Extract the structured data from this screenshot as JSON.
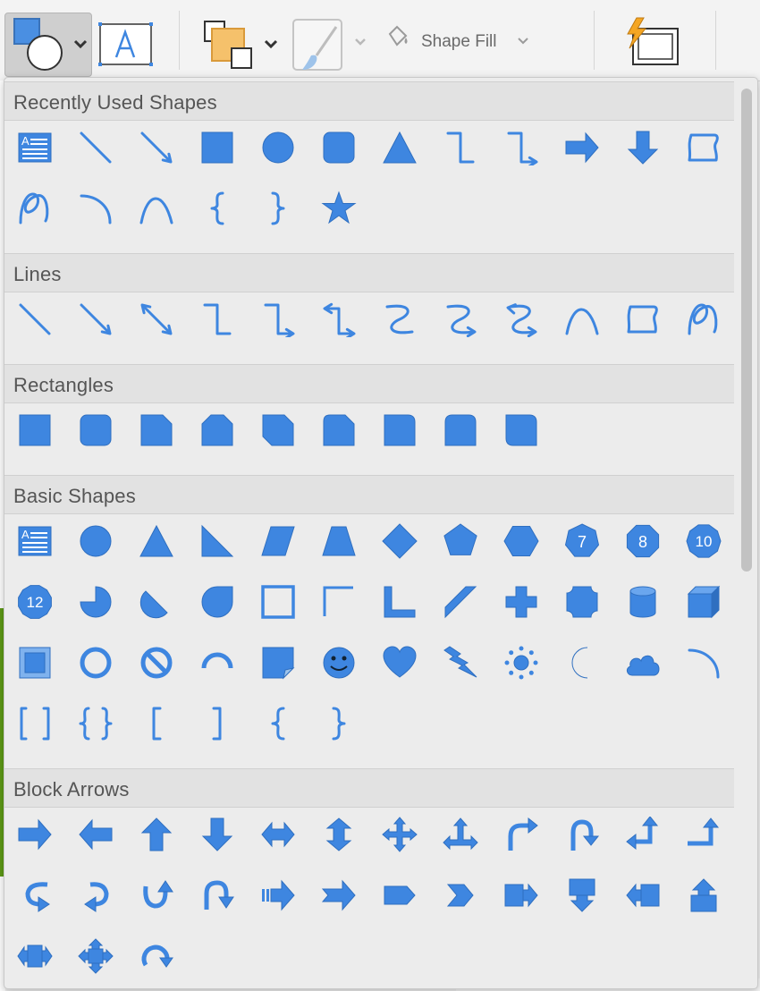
{
  "toolbar": {
    "shape_fill_label": "Shape Fill",
    "icons": [
      "insert-shape-icon",
      "text-box-icon",
      "arrange-icon",
      "format-painter-icon",
      "shape-fill-icon",
      "quick-styles-icon"
    ]
  },
  "colors": {
    "accent": "#3e86e0",
    "panel": "#ececec",
    "header": "#e2e2e2",
    "header_text": "#555555"
  },
  "sections": [
    {
      "title": "Recently Used Shapes",
      "rows": [
        [
          "text-box",
          "line",
          "arrow-line",
          "rectangle",
          "oval",
          "rounded-rectangle",
          "triangle",
          "elbow-connector",
          "elbow-arrow-connector",
          "right-arrow",
          "down-arrow",
          "freeform"
        ],
        [
          "scribble",
          "arc",
          "curve",
          "left-brace",
          "right-brace",
          "star"
        ]
      ]
    },
    {
      "title": "Lines",
      "rows": [
        [
          "line",
          "arrow-line",
          "double-arrow-line",
          "elbow-connector",
          "elbow-arrow-connector",
          "elbow-double-arrow-connector",
          "curved-connector",
          "curved-arrow-connector",
          "curved-double-arrow-connector",
          "curve",
          "freeform",
          "scribble"
        ]
      ]
    },
    {
      "title": "Rectangles",
      "rows": [
        [
          "rectangle",
          "rounded-rectangle",
          "snip-single-corner-rectangle",
          "snip-same-side-corner-rectangle",
          "snip-diagonal-corner-rectangle",
          "snip-round-rectangle",
          "round-single-corner-rectangle",
          "round-same-side-corner-rectangle",
          "round-diagonal-corner-rectangle"
        ]
      ]
    },
    {
      "title": "Basic Shapes",
      "rows": [
        [
          "text-box",
          "oval",
          "triangle",
          "right-triangle",
          "parallelogram",
          "trapezoid",
          "diamond",
          "pentagon",
          "hexagon",
          "heptagon",
          "octagon",
          "decagon"
        ],
        [
          "dodecagon",
          "pie",
          "chord",
          "teardrop",
          "frame",
          "half-frame",
          "l-shape",
          "diagonal-stripe",
          "cross",
          "plaque",
          "can",
          "cube"
        ],
        [
          "bevel",
          "donut",
          "no-symbol",
          "block-arc",
          "folded-corner",
          "smiley-face",
          "heart",
          "lightning-bolt",
          "sun",
          "moon",
          "cloud",
          "arc"
        ],
        [
          "double-bracket",
          "double-brace",
          "left-bracket",
          "right-bracket",
          "left-brace",
          "right-brace"
        ]
      ],
      "badges": {
        "heptagon": "7",
        "octagon": "8",
        "decagon": "10",
        "dodecagon": "12"
      }
    },
    {
      "title": "Block Arrows",
      "rows": [
        [
          "right-arrow",
          "left-arrow",
          "up-arrow",
          "down-arrow",
          "left-right-arrow",
          "up-down-arrow",
          "quad-arrow",
          "left-right-up-arrow",
          "bent-arrow",
          "u-turn-arrow",
          "left-up-arrow",
          "bent-up-arrow"
        ],
        [
          "curved-right-arrow",
          "curved-left-arrow",
          "curved-up-arrow",
          "curved-down-arrow",
          "striped-right-arrow",
          "notched-right-arrow",
          "pentagon-arrow",
          "chevron-arrow",
          "right-arrow-callout",
          "down-arrow-callout",
          "left-arrow-callout",
          "up-arrow-callout"
        ],
        [
          "left-right-arrow-callout",
          "quad-arrow-callout",
          "circular-arrow"
        ]
      ]
    }
  ]
}
